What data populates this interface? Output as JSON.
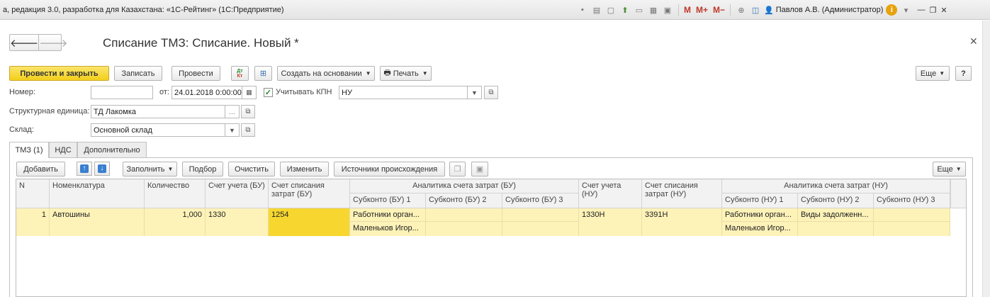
{
  "window": {
    "title": "а, редакция 3.0, разработка для Казахстана: «1С-Рейтинг» (1С:Предприятие)",
    "user": "Павлов А.В. (Администратор)",
    "memory_buttons": [
      "M",
      "M+",
      "M−"
    ]
  },
  "form": {
    "title": "Списание ТМЗ: Списание. Новый *"
  },
  "toolbar": {
    "post_close": "Провести и закрыть",
    "save": "Записать",
    "post": "Провести",
    "dt_kt_top": "Дт",
    "dt_kt_bottom": "Кт",
    "create_based": "Создать на основании",
    "print": "Печать",
    "more": "Еще",
    "help": "?"
  },
  "fields": {
    "number_label": "Номер:",
    "number_value": "",
    "date_label": "от:",
    "date_value": "24.01.2018 0:00:00",
    "kpn_label": "Учитывать КПН",
    "kpn_value": "НУ",
    "unit_label": "Структурная единица:",
    "unit_value": "ТД Лакомка",
    "warehouse_label": "Склад:",
    "warehouse_value": "Основной склад"
  },
  "tabs": [
    "ТМЗ (1)",
    "НДС",
    "Дополнительно"
  ],
  "table_toolbar": {
    "add": "Добавить",
    "fill": "Заполнить",
    "select": "Подбор",
    "clear": "Очистить",
    "change": "Изменить",
    "sources": "Источники происхождения",
    "more": "Еще"
  },
  "table": {
    "headers": {
      "n": "N",
      "nomenclature": "Номенклатура",
      "quantity": "Количество",
      "account_bu": "Счет учета (БУ)",
      "writeoff_bu": "Счет списания затрат (БУ)",
      "analytics_bu": "Аналитика счета затрат (БУ)",
      "sub_bu1": "Субконто (БУ) 1",
      "sub_bu2": "Субконто (БУ) 2",
      "sub_bu3": "Субконто (БУ) 3",
      "account_nu": "Счет учета (НУ)",
      "writeoff_nu": "Счет списания затрат (НУ)",
      "analytics_nu": "Аналитика счета затрат (НУ)",
      "sub_nu1": "Субконто (НУ) 1",
      "sub_nu2": "Субконто (НУ) 2",
      "sub_nu3": "Субконто (НУ) 3"
    },
    "rows": [
      {
        "n": "1",
        "nomenclature": "Автошины",
        "quantity": "1,000",
        "account_bu": "1330",
        "writeoff_bu": "1254",
        "sub_bu1_a": "Работники орган...",
        "sub_bu1_b": "Маленьков Игор...",
        "account_nu": "1330Н",
        "writeoff_nu": "3391Н",
        "sub_nu1_a": "Работники орган...",
        "sub_nu1_b": "Маленьков Игор...",
        "sub_nu2_a": "Виды задолженн..."
      }
    ]
  }
}
